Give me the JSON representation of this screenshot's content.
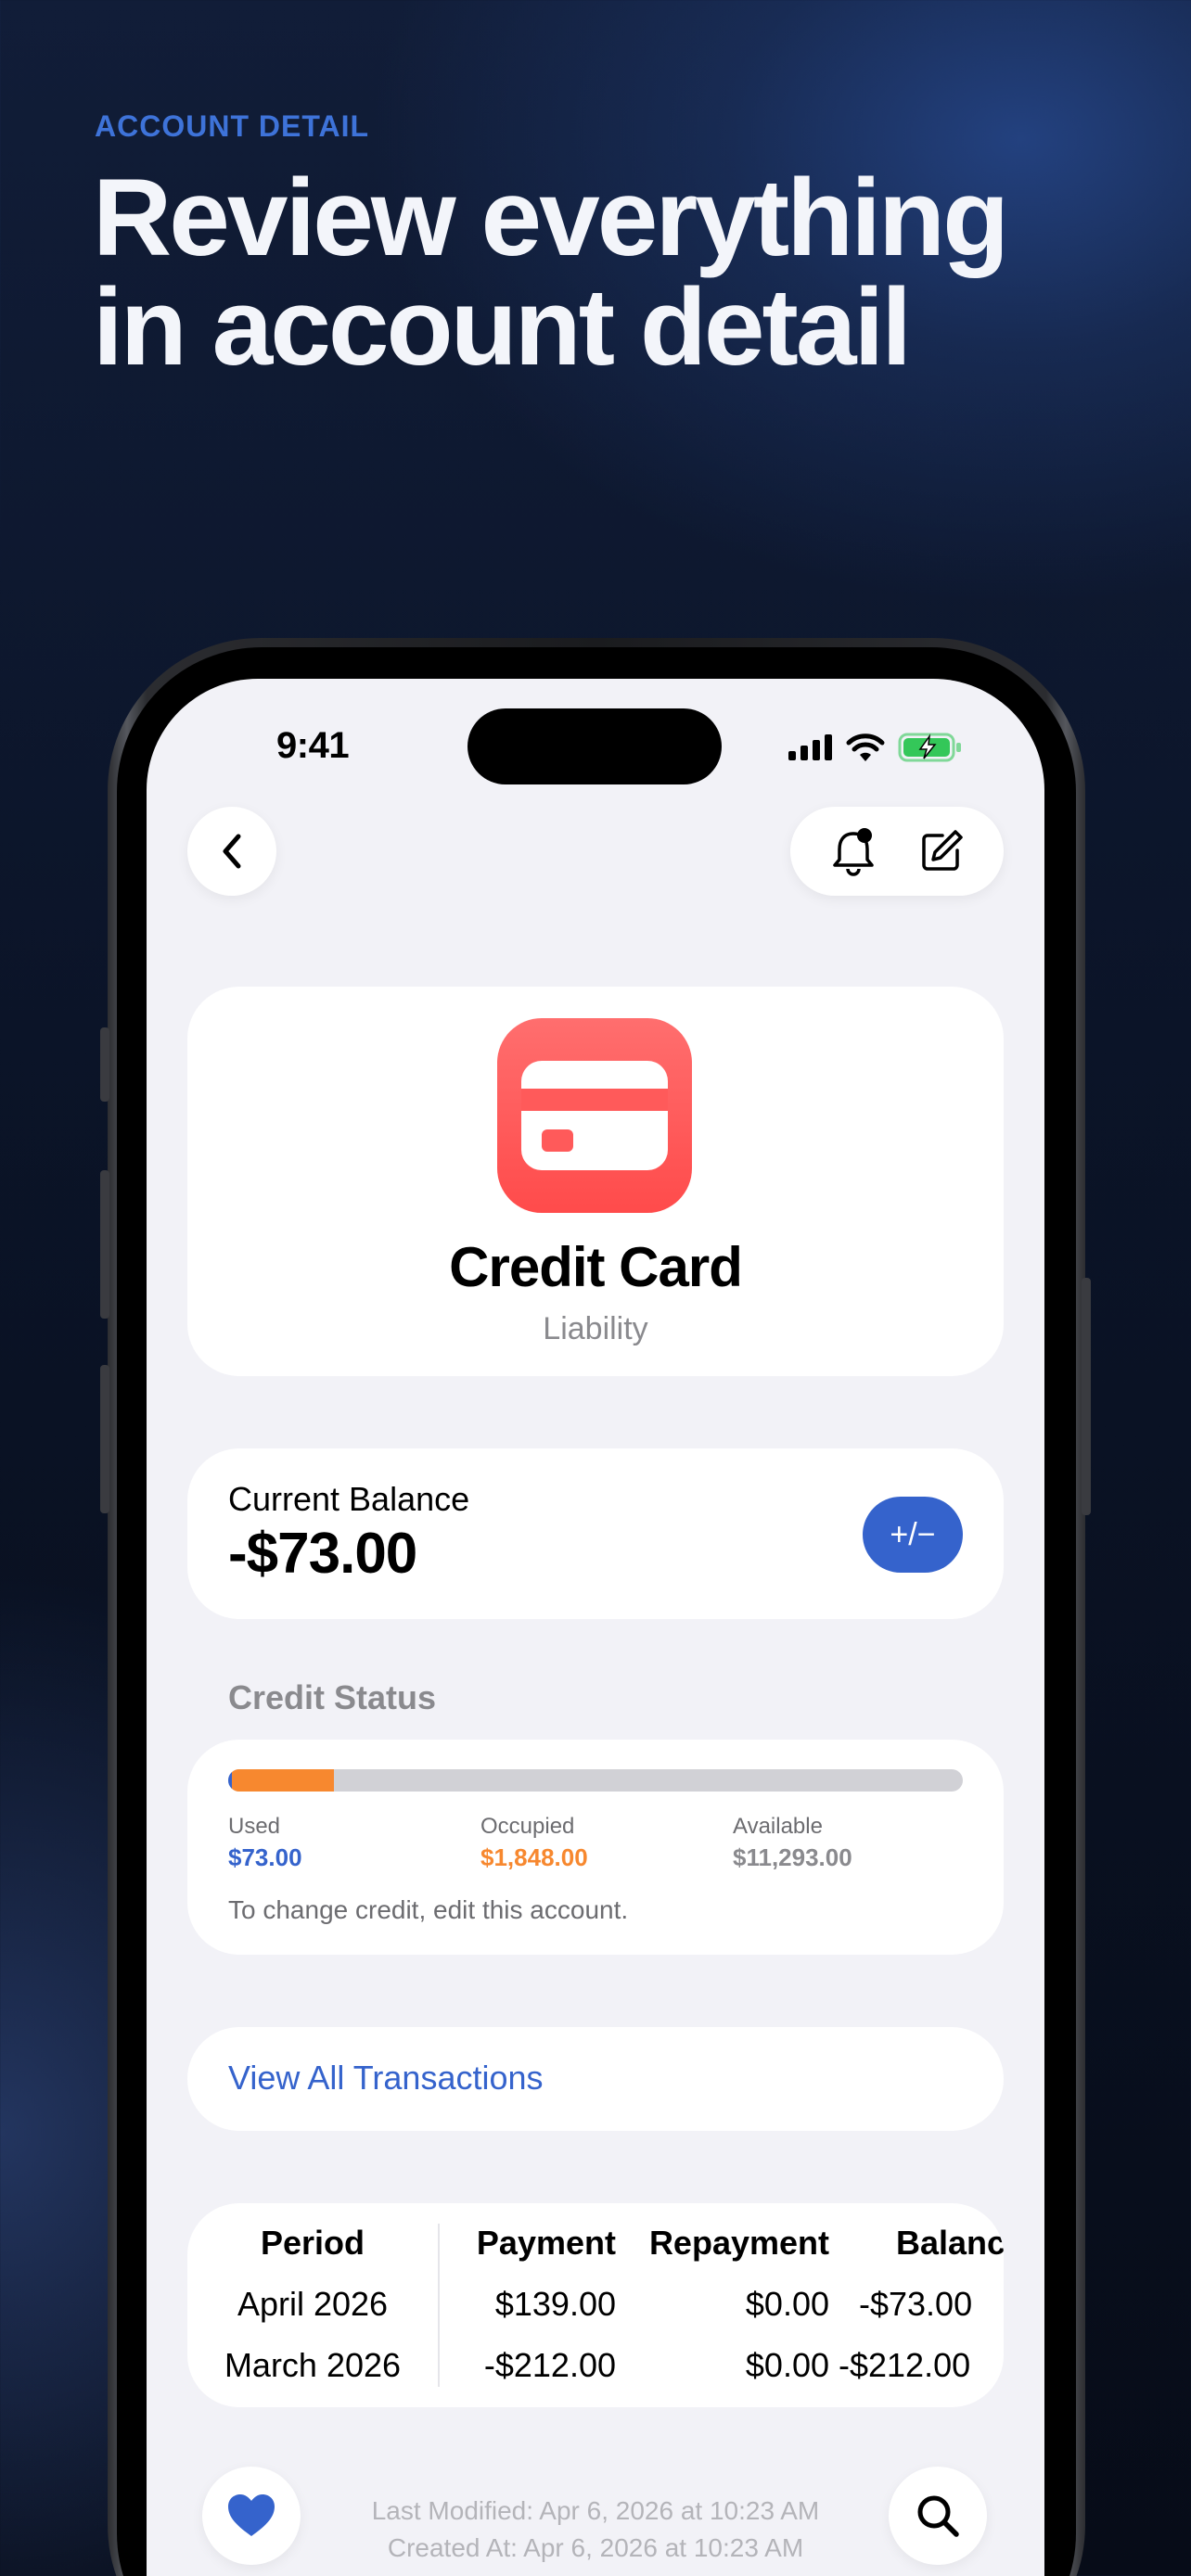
{
  "promo": {
    "eyebrow": "ACCOUNT DETAIL",
    "headline_line1": "Review everything",
    "headline_line2": "in account detail"
  },
  "status_bar": {
    "time": "9:41"
  },
  "account": {
    "name": "Credit Card",
    "type": "Liability",
    "icon": "credit-card-icon",
    "icon_color": "#ff5a5a"
  },
  "balance": {
    "label": "Current Balance",
    "value": "-$73.00",
    "adjust_symbol": "+/−"
  },
  "credit_status": {
    "title": "Credit Status",
    "used_label": "Used",
    "used_value": "$73.00",
    "occupied_label": "Occupied",
    "occupied_value": "$1,848.00",
    "available_label": "Available",
    "available_value": "$11,293.00",
    "used_fraction": 0.0055,
    "occupied_fraction": 0.139,
    "note": "To change credit, edit this account.",
    "colors": {
      "used": "#3563cc",
      "occupied": "#f7882f",
      "available": "#8a8a8e"
    }
  },
  "transactions_link": "View All Transactions",
  "period_table": {
    "headers": [
      "Period",
      "Payment",
      "Repayment",
      "Balance"
    ],
    "rows": [
      [
        "April 2026",
        "$139.00",
        "$0.00",
        "-$73.00"
      ],
      [
        "March 2026",
        "-$212.00",
        "$0.00",
        "-$212.00"
      ]
    ]
  },
  "footer": {
    "modified": "Last Modified: Apr 6, 2026 at 10:23 AM",
    "created": "Created At: Apr 6, 2026 at 10:23 AM"
  },
  "accent_color": "#3563cc"
}
